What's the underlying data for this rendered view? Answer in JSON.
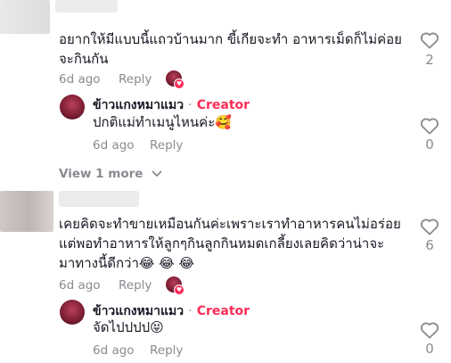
{
  "comments": [
    {
      "text_line1": "อยากให้มีแบบนี้แถวบ้านมาก ขี้เกียจะทำ อาหารเม็ดก็ไม่ค่อย",
      "text_line2": "จะกินกัน",
      "time": "6d ago",
      "reply_label": "Reply",
      "likes": "2",
      "creator_reply": {
        "author": "ข้าวแกงหมาแมว",
        "separator": "·",
        "badge": "Creator",
        "text": "ปกติแม่ทำเมนูไหนค่ะ🥰",
        "time": "6d ago",
        "reply_label": "Reply",
        "likes": "0"
      },
      "view_more": "View 1 more"
    },
    {
      "text_line1": "เคยคิดจะทำขายเหมือนกันค่ะเพราะเราทำอาหารคนไม่อร่อย",
      "text_line2": "แต่พอทำอาหารให้ลูกๆกินลูกกินหมดเกลี้ยงเลยคิดว่าน่าจะ",
      "text_line3": "มาทางนี้ดีกว่า😂 😂 😂",
      "time": "6d ago",
      "reply_label": "Reply",
      "likes": "6",
      "creator_reply": {
        "author": "ข้าวแกงหมาแมว",
        "separator": "·",
        "badge": "Creator",
        "text": "จัดไปปปป😝",
        "time": "6d ago",
        "reply_label": "Reply",
        "likes": "0"
      }
    }
  ],
  "colors": {
    "creator": "#fe2c55",
    "muted": "#8a8b91",
    "text": "#161823"
  },
  "icons": [
    "heart-outline-icon",
    "chevron-down-icon",
    "creator-liked-badge-icon"
  ]
}
